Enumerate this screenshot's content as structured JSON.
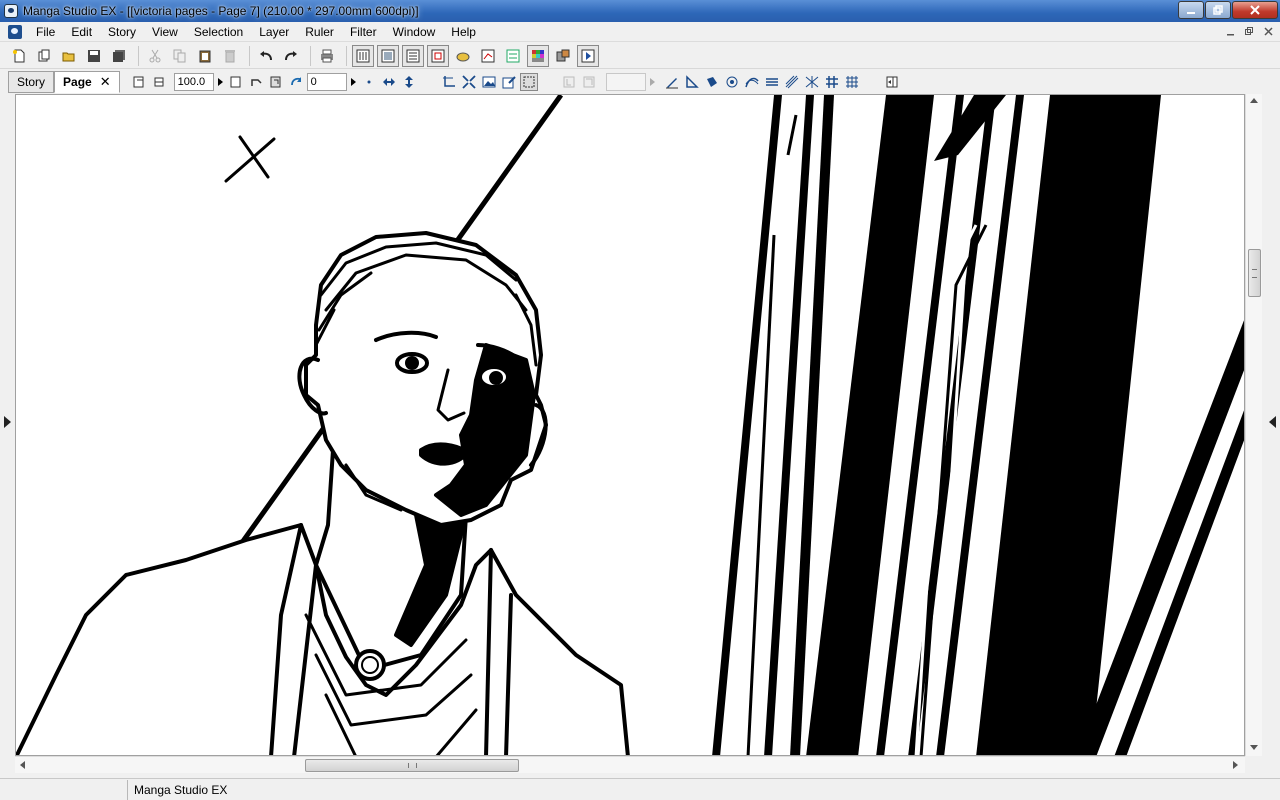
{
  "window": {
    "title": "Manga Studio EX - [[victoria pages - Page 7] (210.00 * 297.00mm 600dpi)]",
    "minimize_icon": "minimize-icon",
    "maximize_icon": "restore-icon",
    "close_icon": "close-icon"
  },
  "menu": {
    "items": [
      "File",
      "Edit",
      "Story",
      "View",
      "Selection",
      "Layer",
      "Ruler",
      "Filter",
      "Window",
      "Help"
    ]
  },
  "toolbar2": {
    "tabs": {
      "story": "Story",
      "page": "Page"
    },
    "zoom_value": "100.0",
    "rotation_value": "0"
  },
  "status": {
    "app_name": "Manga Studio EX"
  },
  "colors": {
    "titlebar": "#2d67b8",
    "ink": "#000000",
    "paper": "#ffffff"
  }
}
